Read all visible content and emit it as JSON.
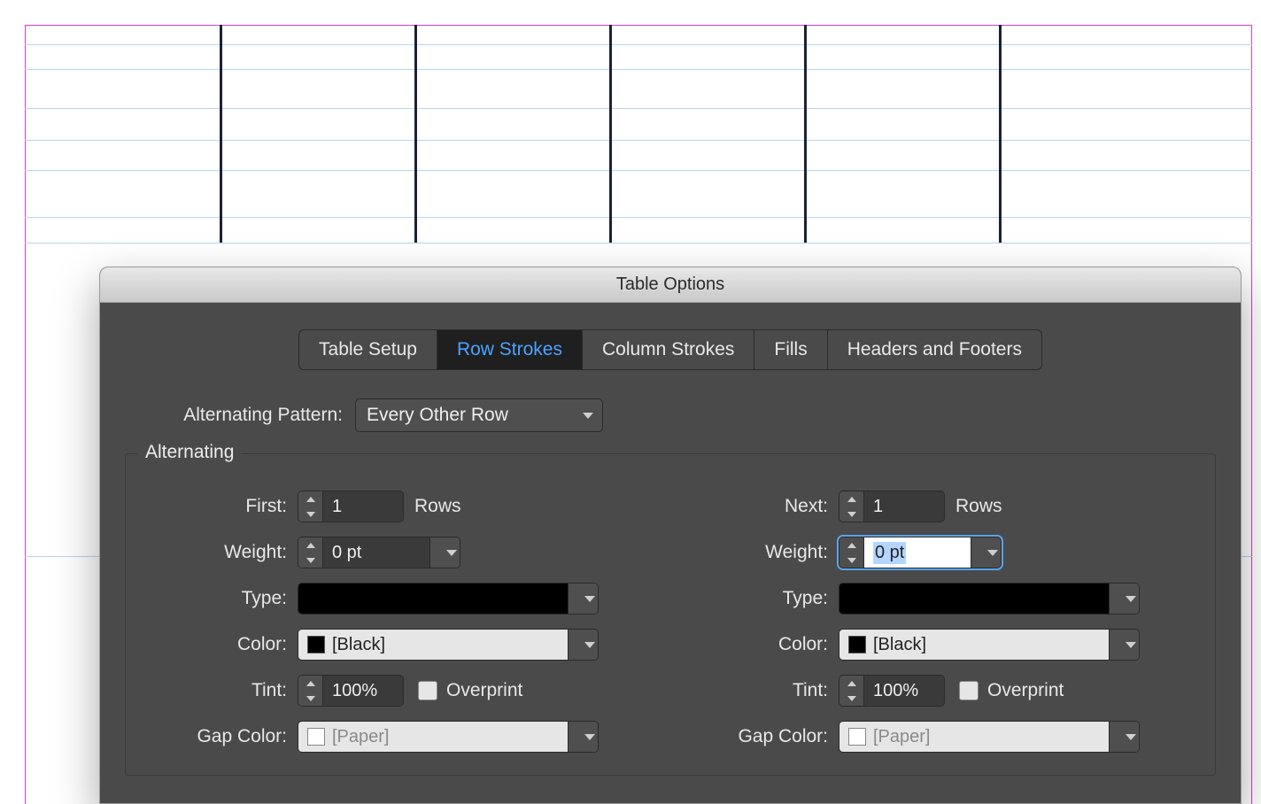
{
  "dialog": {
    "title": "Table Options",
    "tabs": [
      "Table Setup",
      "Row Strokes",
      "Column Strokes",
      "Fills",
      "Headers and Footers"
    ],
    "active_tab": "Row Strokes",
    "pattern_label": "Alternating Pattern:",
    "pattern_value": "Every Other Row",
    "fieldset_title": "Alternating",
    "first": {
      "first_label": "First:",
      "first_value": "1",
      "first_unit": "Rows",
      "weight_label": "Weight:",
      "weight_value": "0 pt",
      "type_label": "Type:",
      "color_label": "Color:",
      "color_value": "[Black]",
      "tint_label": "Tint:",
      "tint_value": "100%",
      "overprint_label": "Overprint",
      "gap_color_label": "Gap Color:",
      "gap_color_value": "[Paper]"
    },
    "next": {
      "first_label": "Next:",
      "first_value": "1",
      "first_unit": "Rows",
      "weight_label": "Weight:",
      "weight_value": "0 pt",
      "type_label": "Type:",
      "color_label": "Color:",
      "color_value": "[Black]",
      "tint_label": "Tint:",
      "tint_value": "100%",
      "overprint_label": "Overprint",
      "gap_color_label": "Gap Color:",
      "gap_color_value": "[Paper]"
    }
  }
}
